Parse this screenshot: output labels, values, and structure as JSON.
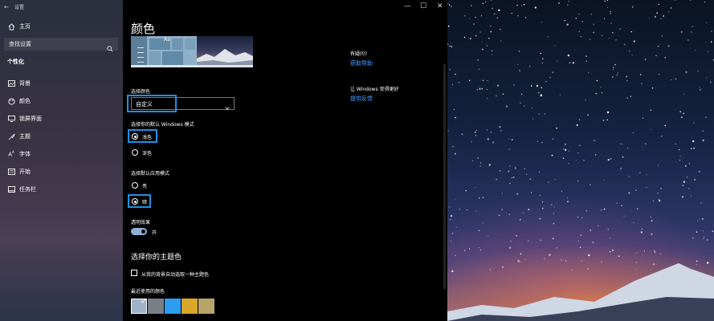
{
  "window": {
    "title": "设置",
    "controls": {
      "minimize": "—",
      "maximize": "☐",
      "close": "✕"
    }
  },
  "sidebar": {
    "home": "主页",
    "search_placeholder": "查找设置",
    "section": "个性化",
    "items": [
      {
        "label": "背景",
        "icon": "picture-icon"
      },
      {
        "label": "颜色",
        "icon": "palette-icon"
      },
      {
        "label": "锁屏界面",
        "icon": "monitor-icon"
      },
      {
        "label": "主题",
        "icon": "brush-icon"
      },
      {
        "label": "字体",
        "icon": "font-icon"
      },
      {
        "label": "开始",
        "icon": "start-icon"
      },
      {
        "label": "任务栏",
        "icon": "taskbar-icon"
      }
    ]
  },
  "main": {
    "title": "颜色",
    "preview_text": "Aa",
    "choose_color": {
      "label": "选择颜色",
      "value": "自定义"
    },
    "windows_mode": {
      "label": "选择你的默认 Windows 模式",
      "options": [
        "浅色",
        "深色"
      ],
      "selected": "浅色"
    },
    "app_mode": {
      "label": "选择默认应用模式",
      "options": [
        "亮",
        "暗"
      ],
      "selected": "暗"
    },
    "transparency": {
      "label": "透明效果",
      "state": "开",
      "on": true
    },
    "accent": {
      "heading": "选择你的主题色",
      "auto_label": "从我的背景自动选取一种主题色",
      "recent_label": "最近使用的颜色",
      "recent_colors": [
        "#9fb3c8",
        "#7a7f86",
        "#2d9df0",
        "#d9a62a",
        "#b8a46a"
      ]
    }
  },
  "help": {
    "question": "有疑问?",
    "get_help": "获取帮助",
    "improve": "让 Windows 变得更好",
    "feedback": "提供反馈"
  },
  "colors": {
    "accent": "#1e90e6",
    "link": "#4aa3ff"
  }
}
